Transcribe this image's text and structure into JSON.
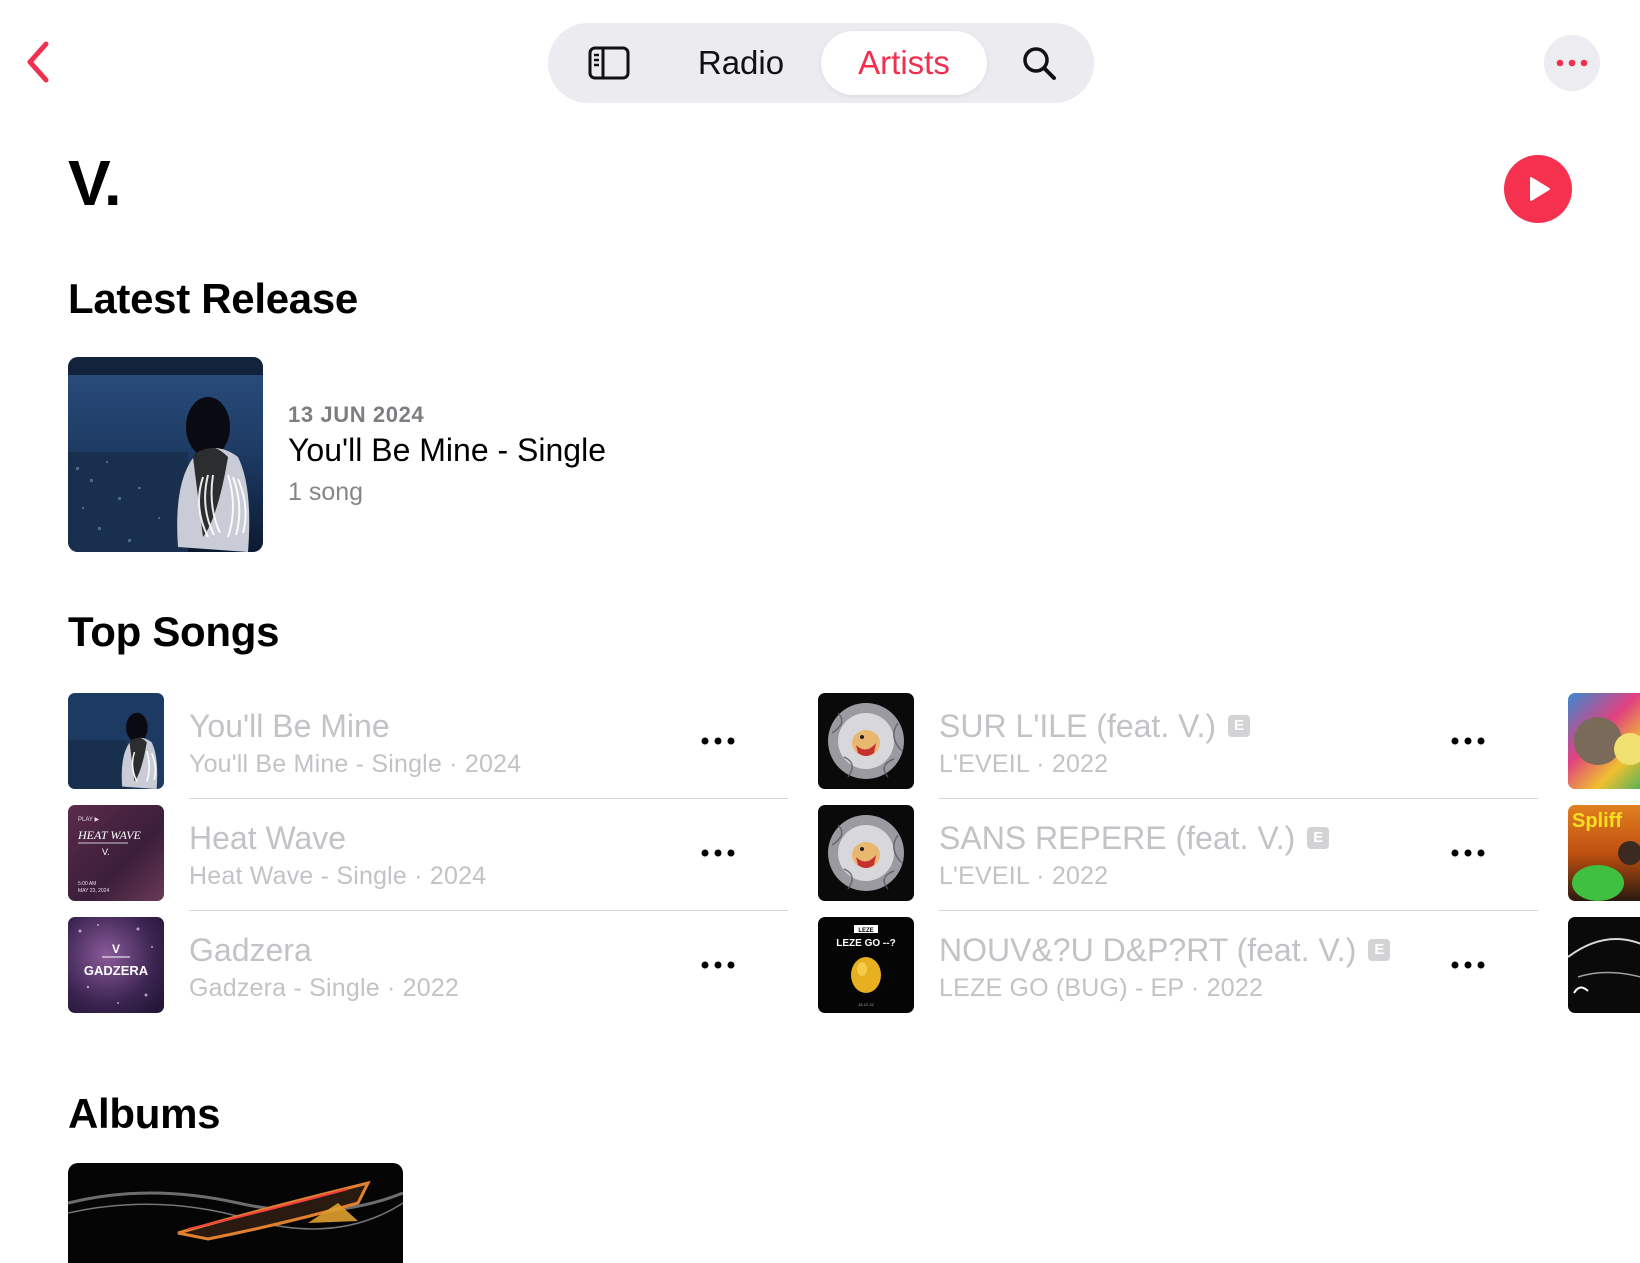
{
  "nav": {
    "back_icon": "chevron-left-icon",
    "tabs": [
      {
        "icon": "sidebar-icon"
      },
      {
        "label": "Radio"
      },
      {
        "label": "Artists",
        "selected": true
      },
      {
        "icon": "search-icon"
      }
    ],
    "more_icon": "ellipsis-icon"
  },
  "artist": {
    "name": "V.",
    "play_icon": "play-icon"
  },
  "latest_release": {
    "heading": "Latest Release",
    "date": "13 JUN 2024",
    "title": "You'll Be Mine - Single",
    "count": "1 song"
  },
  "top_songs": {
    "heading": "Top Songs",
    "columns": [
      [
        {
          "title": "You'll Be Mine",
          "subtitle": "You'll Be Mine - Single · 2024",
          "explicit": false
        },
        {
          "title": "Heat Wave",
          "subtitle": "Heat Wave - Single · 2024",
          "explicit": false
        },
        {
          "title": "Gadzera",
          "subtitle": "Gadzera - Single · 2022",
          "explicit": false
        }
      ],
      [
        {
          "title": "SUR L'ILE (feat. V.)",
          "subtitle": "L'EVEIL · 2022",
          "explicit": true
        },
        {
          "title": "SANS REPERE (feat. V.)",
          "subtitle": "L'EVEIL · 2022",
          "explicit": true
        },
        {
          "title": "NOUV&?U D&P?RT (feat. V.)",
          "subtitle": "LEZE GO (BUG) - EP · 2022",
          "explicit": true
        }
      ]
    ],
    "explicit_badge": "E"
  },
  "albums": {
    "heading": "Albums"
  },
  "artwork_text": {
    "heat_wave_cover": [
      "PLAY ▶",
      "HEAT WAVE",
      "V.",
      "5:00 AM",
      "MAY 23, 2024"
    ],
    "gadzera_cover": [
      "V",
      "GADZERA"
    ],
    "leze_cover": [
      "LEZE",
      "LEZE GO --?",
      "16.12.22"
    ],
    "spliff_cover": [
      "Spliff"
    ]
  },
  "colors": {
    "accent": "#f5314f",
    "muted_text": "#c3c3c7",
    "segment_bg": "#ebebf0"
  }
}
